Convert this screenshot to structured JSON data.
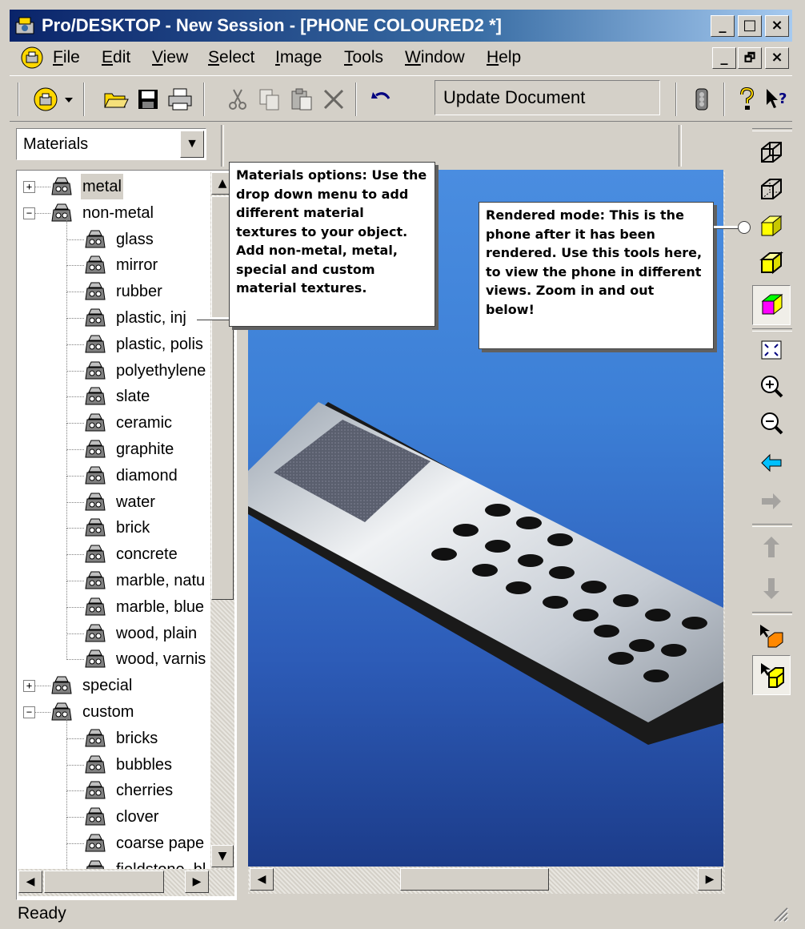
{
  "window": {
    "title": "Pro/DESKTOP - New Session - [PHONE COLOURED2 *]",
    "caption_buttons": [
      "_",
      "□",
      "×"
    ],
    "doc_buttons": [
      "_",
      "🗗",
      "×"
    ]
  },
  "menu": {
    "items": [
      {
        "label": "File",
        "u": "F",
        "rest": "ile"
      },
      {
        "label": "Edit",
        "u": "E",
        "rest": "dit"
      },
      {
        "label": "View",
        "u": "V",
        "rest": "iew"
      },
      {
        "label": "Select",
        "u": "S",
        "rest": "elect"
      },
      {
        "label": "Image",
        "u": "I",
        "rest": "mage"
      },
      {
        "label": "Tools",
        "u": "T",
        "rest": "ools"
      },
      {
        "label": "Window",
        "u": "W",
        "rest": "indow"
      },
      {
        "label": "Help",
        "u": "H",
        "rest": "elp"
      }
    ]
  },
  "toolbar": {
    "update_document": "Update Document",
    "icons": [
      "app-menu-icon",
      "dropdown-arrow-icon",
      "open-folder-icon",
      "save-icon",
      "print-icon",
      "cut-icon",
      "copy-icon",
      "paste-icon",
      "delete-icon",
      "undo-icon",
      "traffic-light-icon",
      "help-icon",
      "context-help-icon"
    ]
  },
  "left_pane": {
    "dropdown_value": "Materials",
    "tree": [
      {
        "label": "metal",
        "level": 0,
        "expander": "+",
        "selected": true
      },
      {
        "label": "non-metal",
        "level": 0,
        "expander": "−"
      },
      {
        "label": "glass",
        "level": 1
      },
      {
        "label": "mirror",
        "level": 1
      },
      {
        "label": "rubber",
        "level": 1
      },
      {
        "label": "plastic, inj",
        "level": 1
      },
      {
        "label": "plastic, polis",
        "level": 1
      },
      {
        "label": "polyethylene",
        "level": 1
      },
      {
        "label": "slate",
        "level": 1
      },
      {
        "label": "ceramic",
        "level": 1
      },
      {
        "label": "graphite",
        "level": 1
      },
      {
        "label": "diamond",
        "level": 1
      },
      {
        "label": "water",
        "level": 1
      },
      {
        "label": "brick",
        "level": 1
      },
      {
        "label": "concrete",
        "level": 1
      },
      {
        "label": "marble, natu",
        "level": 1
      },
      {
        "label": "marble, blue",
        "level": 1
      },
      {
        "label": "wood, plain",
        "level": 1
      },
      {
        "label": "wood, varnis",
        "level": 1
      },
      {
        "label": "special",
        "level": 0,
        "expander": "+"
      },
      {
        "label": "custom",
        "level": 0,
        "expander": "−"
      },
      {
        "label": "bricks",
        "level": 1
      },
      {
        "label": "bubbles",
        "level": 1
      },
      {
        "label": "cherries",
        "level": 1
      },
      {
        "label": "clover",
        "level": 1
      },
      {
        "label": "coarse pape",
        "level": 1
      },
      {
        "label": "fieldstone, bl",
        "level": 1
      }
    ]
  },
  "callouts": {
    "materials": "Materials options: Use the drop down menu to add different material textures to your object. Add non-metal, metal, special and custom material textures.",
    "rendered": "Rendered mode: This is the phone after it has been rendered. Use this tools here, to view the phone in different views. Zoom in and out below!"
  },
  "right_toolbar": {
    "icons": [
      "wireframe-isometric-icon",
      "hidden-line-icon",
      "shaded-icon",
      "enhanced-shaded-icon",
      "rendered-icon",
      "zoom-fit-icon",
      "zoom-in-icon",
      "zoom-out-icon",
      "pan-left-icon",
      "pan-right-icon",
      "pan-up-icon",
      "pan-down-icon",
      "view-object-icon",
      "view-selected-icon"
    ]
  },
  "status": {
    "text": "Ready"
  },
  "colors": {
    "titlebar_start": "#0a246a",
    "titlebar_end": "#a6caf0",
    "viewport_top": "#4a8de0",
    "viewport_bottom": "#1c3c8a",
    "chrome": "#d4d0c8"
  }
}
